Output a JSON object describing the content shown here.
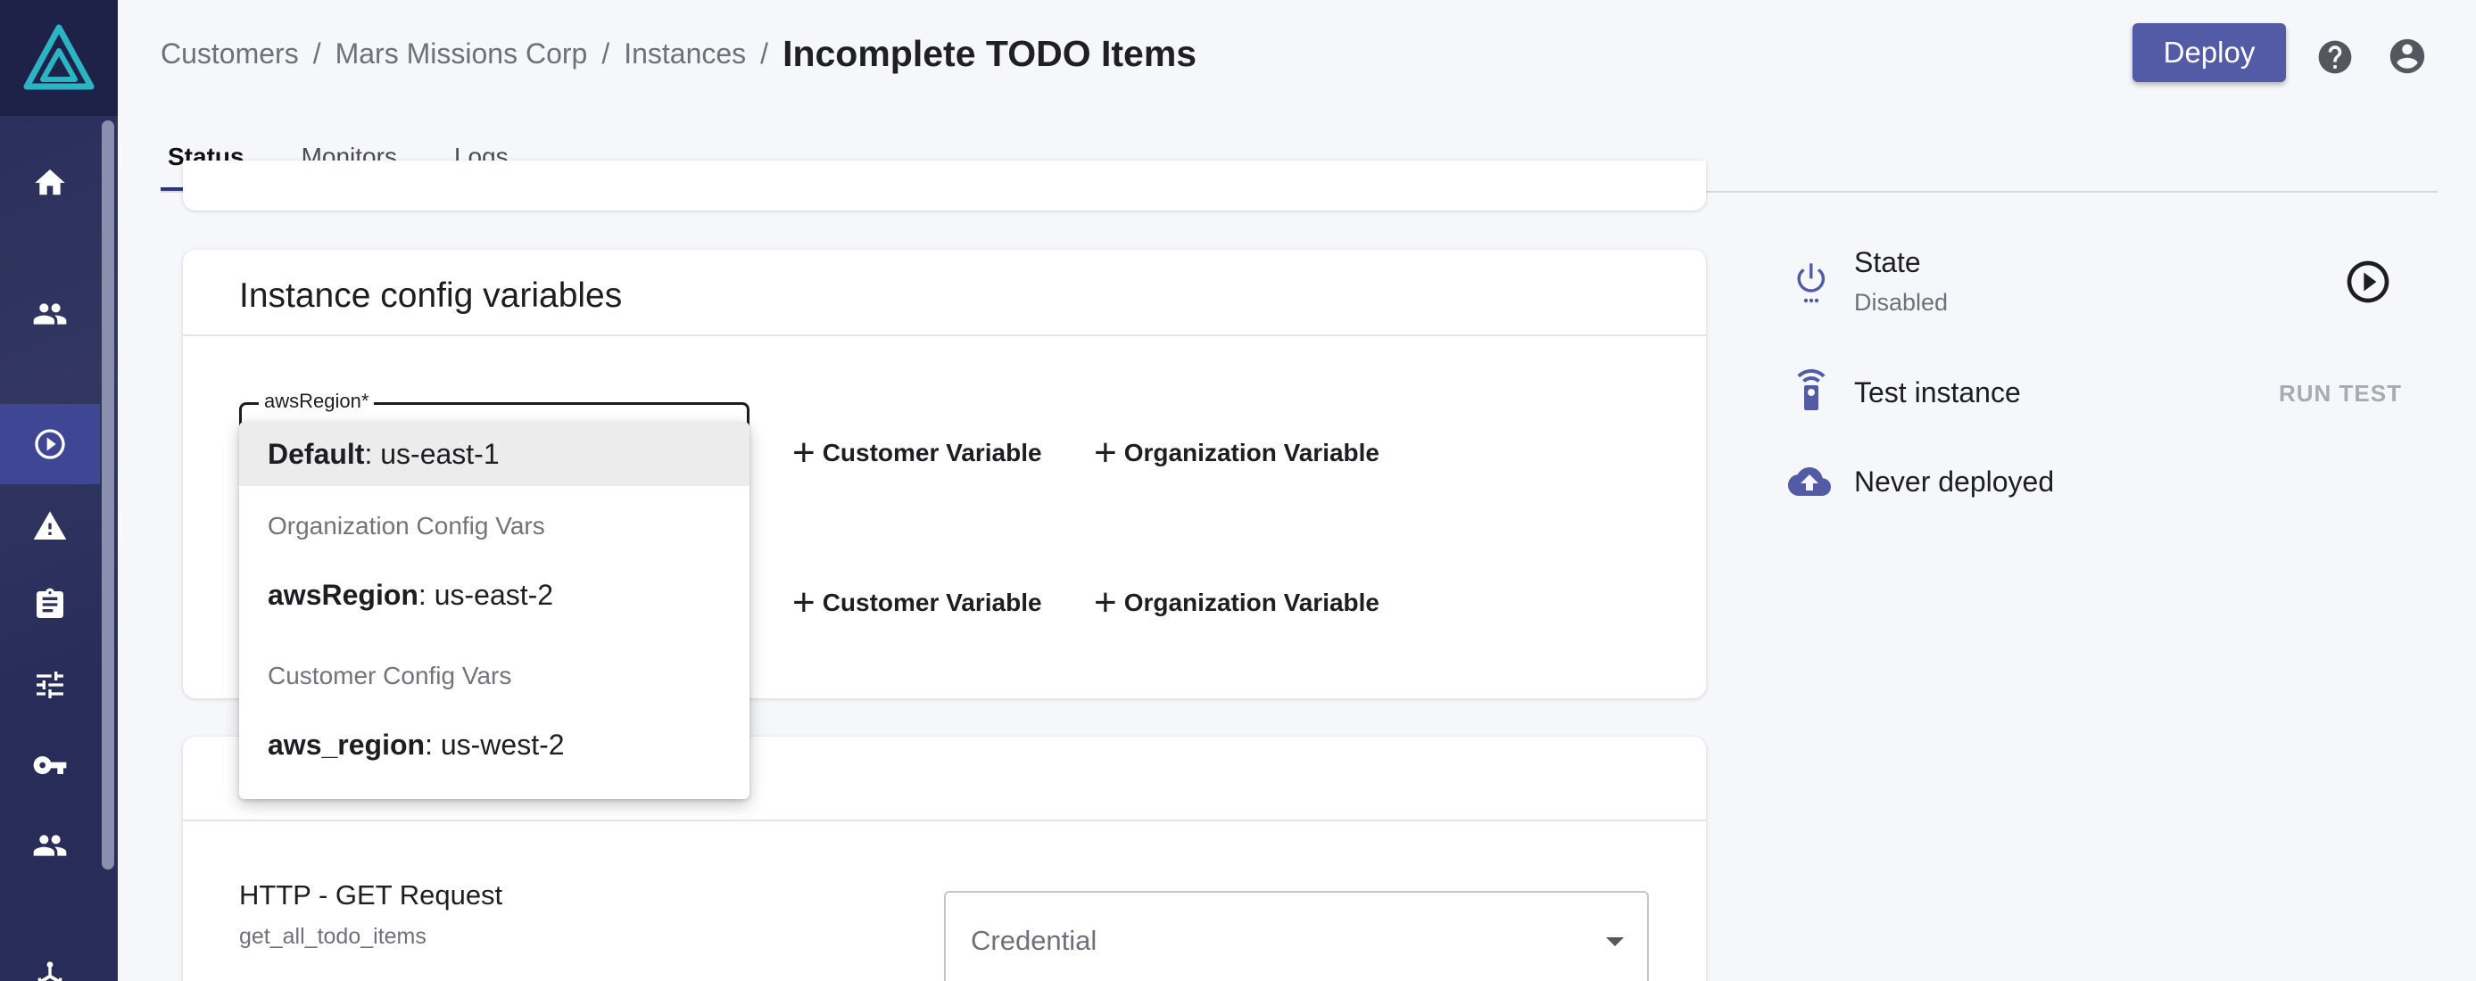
{
  "header": {
    "breadcrumb": [
      "Customers",
      "Mars Missions Corp",
      "Instances"
    ],
    "breadcrumb_separator": "/",
    "title": "Incomplete TODO Items",
    "deploy_label": "Deploy",
    "accent_color": "#535ba7"
  },
  "sidebar": {
    "background": "#272c59",
    "items": [
      {
        "icon": "home-icon",
        "active": false
      },
      {
        "icon": "customers-icon",
        "active": false
      },
      {
        "icon": "instances-play-icon",
        "active": true
      },
      {
        "icon": "alert-warning-icon",
        "active": false
      },
      {
        "icon": "clipboard-icon",
        "active": false
      },
      {
        "icon": "tune-sliders-icon",
        "active": false
      },
      {
        "icon": "key-icon",
        "active": false
      },
      {
        "icon": "users-icon",
        "active": false
      },
      {
        "icon": "integrations-icon",
        "active": false
      }
    ]
  },
  "tabs": [
    {
      "label": "Status",
      "active": true
    },
    {
      "label": "Monitors",
      "active": false
    },
    {
      "label": "Logs",
      "active": false
    }
  ],
  "config": {
    "title": "Instance config variables",
    "field_label": "awsRegion*",
    "add_customer_label": "Customer Variable",
    "add_org_label": "Organization Variable"
  },
  "dropdown": {
    "default_option": {
      "key": "Default",
      "value": ": us-east-1"
    },
    "org_header": "Organization Config Vars",
    "org_option": {
      "key": "awsRegion",
      "value": ": us-east-2"
    },
    "customer_header": "Customer Config Vars",
    "customer_option": {
      "key": "aws_region",
      "value": ": us-west-2"
    }
  },
  "action": {
    "name": "HTTP - GET Request",
    "key": "get_all_todo_items",
    "credential_placeholder": "Credential"
  },
  "status_panel": {
    "state_label": "State",
    "state_value": "Disabled",
    "test_label": "Test instance",
    "run_test_label": "RUN TEST",
    "deploy_status": "Never deployed"
  }
}
